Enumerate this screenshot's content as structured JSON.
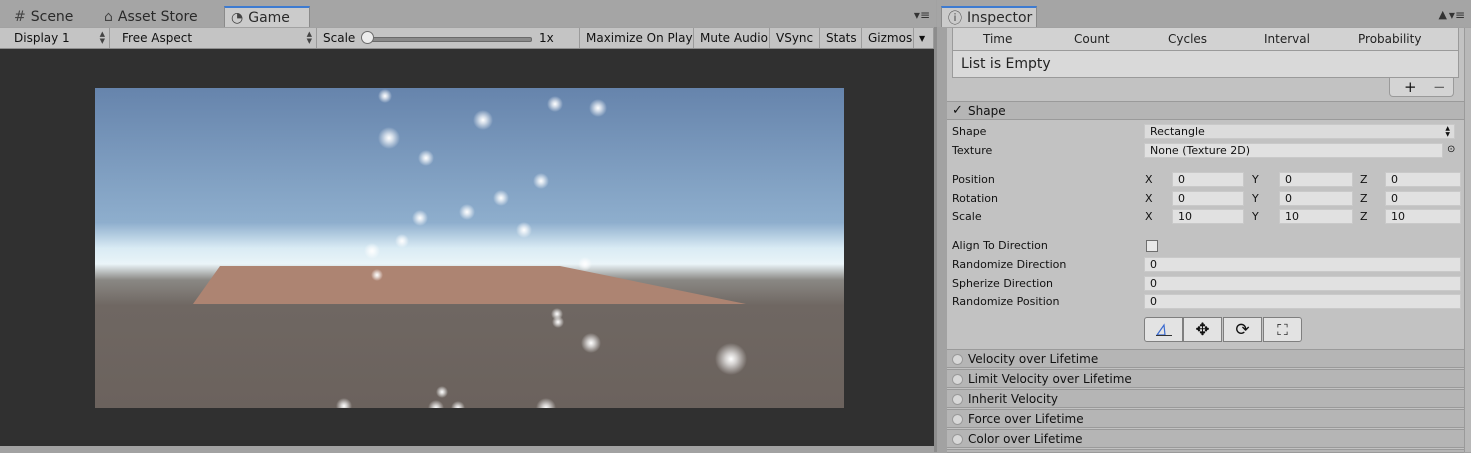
{
  "tabs": {
    "scene": "Scene",
    "asset_store": "Asset Store",
    "game": "Game",
    "menu_glyph": "▾≡"
  },
  "inspector_tab": {
    "label": "Inspector",
    "lock_glyph": "🔒",
    "menu_glyph": "▾≡"
  },
  "game_toolbar": {
    "display": "Display 1",
    "aspect": "Free Aspect",
    "scale_label": "Scale",
    "scale_value": "1x",
    "maximize": "Maximize On Play",
    "mute": "Mute Audio",
    "vsync": "VSync",
    "stats": "Stats",
    "gizmos": "Gizmos"
  },
  "bursts": {
    "columns": [
      "Time",
      "Count",
      "Cycles",
      "Interval",
      "Probability"
    ],
    "empty_text": "List is Empty",
    "add": "+",
    "remove": "−"
  },
  "shape_module": {
    "title": "Shape",
    "enabled": true,
    "shape_label": "Shape",
    "shape_value": "Rectangle",
    "texture_label": "Texture",
    "texture_value": "None (Texture 2D)",
    "position": {
      "label": "Position",
      "x": "0",
      "y": "0",
      "z": "0"
    },
    "rotation": {
      "label": "Rotation",
      "x": "0",
      "y": "0",
      "z": "0"
    },
    "scale": {
      "label": "Scale",
      "x": "10",
      "y": "10",
      "z": "10"
    },
    "axis_x": "X",
    "axis_y": "Y",
    "axis_z": "Z",
    "align_label": "Align To Direction",
    "randomize_dir_label": "Randomize Direction",
    "randomize_dir_value": "0",
    "spherize_label": "Spherize Direction",
    "spherize_value": "0",
    "randomize_pos_label": "Randomize Position",
    "randomize_pos_value": "0"
  },
  "modules": [
    "Velocity over Lifetime",
    "Limit Velocity over Lifetime",
    "Inherit Velocity",
    "Force over Lifetime",
    "Color over Lifetime"
  ],
  "colors": {
    "accent": "#3d7bd1",
    "sky_top": "#6684ac",
    "ground": "#6d6561",
    "plane": "#ad8472"
  }
}
